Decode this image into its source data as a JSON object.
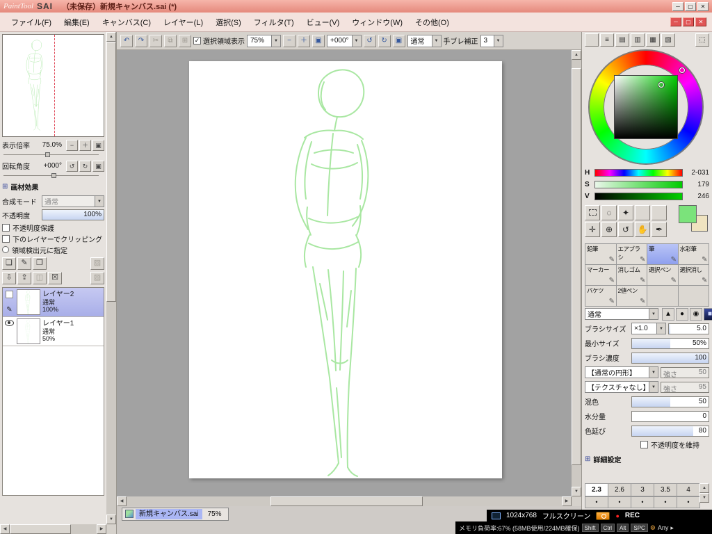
{
  "window": {
    "logo_script": "PaintTool",
    "logo_bold": "SAI",
    "title": "（未保存）新規キャンバス.sai (*)"
  },
  "menubar": {
    "items": [
      "ファイル(F)",
      "編集(E)",
      "キャンバス(C)",
      "レイヤー(L)",
      "選択(S)",
      "フィルタ(T)",
      "ビュー(V)",
      "ウィンドウ(W)",
      "その他(O)"
    ]
  },
  "toolbar": {
    "selection_view_label": "選択領域表示",
    "zoom": "75%",
    "rotation": "+000°",
    "mode": "通常",
    "stabilizer_label": "手ブレ補正",
    "stabilizer": "3"
  },
  "left_panel": {
    "zoom_label": "表示倍率",
    "zoom_value": "75.0%",
    "rot_label": "回転角度",
    "rot_value": "+000°",
    "material_header": "画材効果",
    "blend_label": "合成モード",
    "blend_mode": "通常",
    "opacity_label": "不透明度",
    "opacity_value": "100%",
    "opacity_fill": 100,
    "protect_label": "不透明度保護",
    "clip_label": "下のレイヤーでクリッピング",
    "source_label": "領域検出元に指定",
    "layers": [
      {
        "name": "レイヤー2",
        "mode": "通常",
        "opacity": "100%"
      },
      {
        "name": "レイヤー1",
        "mode": "通常",
        "opacity": "50%"
      }
    ]
  },
  "canvas": {
    "tab_label": "新規キャンバス.sai",
    "tab_zoom": "75%",
    "stroke_color": "#a9e7a2",
    "sketch_paths": [
      "M196,22 C214,6 242,10 250,34 C256,58 240,78 220,80 C200,82 186,66 186,46 C186,34 190,27 196,22",
      "M194,30 C188,44 188,60 196,70",
      "M213,80 C211,88 210,94 209,100",
      "M209,100 C194,98 176,102 166,110",
      "M209,100 C224,98 242,104 250,112",
      "M168,110 C156,134 150,166 154,196 C157,216 164,230 171,242",
      "M176,116 C168,140 164,170 168,198",
      "M248,114 C258,138 260,168 254,196 C250,214 243,227 235,237",
      "M242,120 C250,144 251,172 246,198",
      "M207,104 C203,140 200,180 199,222",
      "M176,148 C196,158 224,156 242,146",
      "M180,132 C198,126 220,126 236,132",
      "M170,210 C168,224 170,238 175,250",
      "M246,208 C248,224 246,238 241,250",
      "M172,226 C194,236 222,234 242,224",
      "M173,250 C166,266 164,282 168,296",
      "M240,250 C248,266 249,282 244,296",
      "M172,262 C196,274 222,272 243,260",
      "M178,296 C186,345 194,400 202,455 C207,500 211,542 215,578",
      "M200,300 C205,345 209,395 211,445",
      "M240,298 C238,350 234,408 230,462 C228,506 227,548 228,584",
      "M222,302 C221,348 219,396 217,444",
      "M205,430 C212,436 222,436 228,430",
      "M212,470 C215,505 217,540 219,570",
      "M188,320 C192,338 196,356 199,372",
      "M233,330 C231,348 229,366 227,382",
      "M215,578 C211,586 206,592 200,596",
      "M228,584 C231,590 236,595 242,597"
    ]
  },
  "color": {
    "h_label": "H",
    "h_value": "2-031",
    "s_label": "S",
    "s_value": "179",
    "v_label": "V",
    "v_value": "246",
    "primary": "#7be37b",
    "secondary": "#efe3c0"
  },
  "tools": {
    "grid": [
      "鉛筆",
      "エアブラシ",
      "筆",
      "水彩筆",
      "マーカー",
      "消しゴム",
      "選択ペン",
      "選択消し",
      "バケツ",
      "2値ペン"
    ]
  },
  "brush": {
    "mode": "通常",
    "size_label": "ブラシサイズ",
    "size_unit": "×1.0",
    "size": "5.0",
    "size_fill": 4,
    "min_label": "最小サイズ",
    "min": "50%",
    "min_fill": 50,
    "density_label": "ブラシ濃度",
    "density": "100",
    "density_fill": 100,
    "shape": "【通常の円形】",
    "strength_label": "強さ",
    "shape_strength": "50",
    "texture": "【テクスチャなし】",
    "texture_strength": "95",
    "blend_label": "混色",
    "blend": "50",
    "blend_fill": 50,
    "water_label": "水分量",
    "water": "0",
    "water_fill": 0,
    "stretch_label": "色延び",
    "stretch": "80",
    "stretch_fill": 80,
    "keep_opacity_label": "不透明度を維持",
    "advanced_label": "詳細設定",
    "presets": [
      "2.3",
      "2.6",
      "3",
      "3.5",
      "4"
    ]
  },
  "status": {
    "resolution": "1024x768",
    "fullscreen": "フルスクリーン",
    "rec": "REC",
    "memory": "メモリ負荷率:67% (58MB使用/224MB確保)",
    "modifiers": [
      "Shift",
      "Ctrl",
      "Alt",
      "SPC"
    ],
    "any": "Any"
  },
  "icons": {
    "minimize": "─",
    "maximize": "▢",
    "close": "✕",
    "undo": "↶",
    "redo": "↷",
    "cut": "✂",
    "copy": "⧉",
    "paste": "⊞",
    "dropdown": "▼",
    "up": "▲",
    "down": "▼",
    "left": "◀",
    "right": "▶",
    "zoom_out": "−",
    "zoom_in": "＋",
    "zoom_fit": "▣",
    "rot_ccw": "↺",
    "rot_cw": "↻",
    "rot_reset": "▣",
    "section_box": "⊞",
    "new_layer": "❏",
    "new_linework": "✎",
    "new_folder": "❒",
    "mask": "▨",
    "transfer_down": "⇩",
    "merge_down": "⇪",
    "clipping": "◫",
    "trash": "☒",
    "effect": "▨",
    "pen": "✎",
    "lasso": "◌",
    "magic_wand": "✦",
    "move": "✛",
    "zoom_tool": "⊕",
    "rotate_tool": "↺",
    "hand": "✋",
    "eyedropper": "✒",
    "shape_triangle": "▲",
    "shape_circle": "●",
    "shape_soft": "◉",
    "shape_square": "■",
    "slider_lines": "≡",
    "panel_a": "▤",
    "panel_b": "▥",
    "panel_c": "▦",
    "panel_d": "▧",
    "panel_e": "⬚",
    "bullet": "•",
    "rec_dot": "●",
    "gear": "⚙",
    "arrow_right": "▸"
  }
}
